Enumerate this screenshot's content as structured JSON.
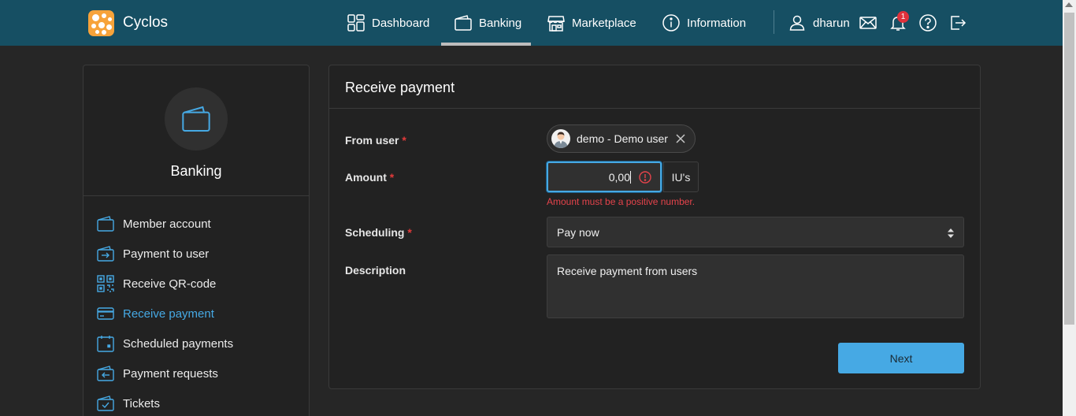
{
  "app": {
    "name": "Cyclos"
  },
  "nav": {
    "items": [
      {
        "label": "Dashboard",
        "icon": "dashboard-icon"
      },
      {
        "label": "Banking",
        "icon": "wallet-icon",
        "active": true
      },
      {
        "label": "Marketplace",
        "icon": "store-icon"
      },
      {
        "label": "Information",
        "icon": "info-icon"
      }
    ],
    "user": "dharun",
    "notification_count": "1",
    "icons": [
      "user-icon",
      "mail-icon",
      "bell-icon",
      "help-icon",
      "logout-icon"
    ]
  },
  "sidebar": {
    "title": "Banking",
    "items": [
      {
        "label": "Member account",
        "icon": "wallet-icon"
      },
      {
        "label": "Payment to user",
        "icon": "payment-out-icon"
      },
      {
        "label": "Receive QR-code",
        "icon": "qr-code-icon"
      },
      {
        "label": "Receive payment",
        "icon": "card-icon",
        "active": true
      },
      {
        "label": "Scheduled payments",
        "icon": "calendar-icon"
      },
      {
        "label": "Payment requests",
        "icon": "payment-in-icon"
      },
      {
        "label": "Tickets",
        "icon": "ticket-check-icon"
      }
    ]
  },
  "form": {
    "title": "Receive payment",
    "from_user_label": "From user",
    "from_user_value": "demo - Demo user",
    "amount_label": "Amount",
    "amount_value": "0,00",
    "amount_unit": "IU's",
    "amount_error": "Amount must be a positive number.",
    "scheduling_label": "Scheduling",
    "scheduling_value": "Pay now",
    "description_label": "Description",
    "description_value": "Receive payment from users",
    "required_mark": "*",
    "next_label": "Next"
  },
  "colors": {
    "topbar": "#164f63",
    "accent": "#46a9e4",
    "error": "#e4434b",
    "background": "#262626",
    "panel": "#222222"
  }
}
